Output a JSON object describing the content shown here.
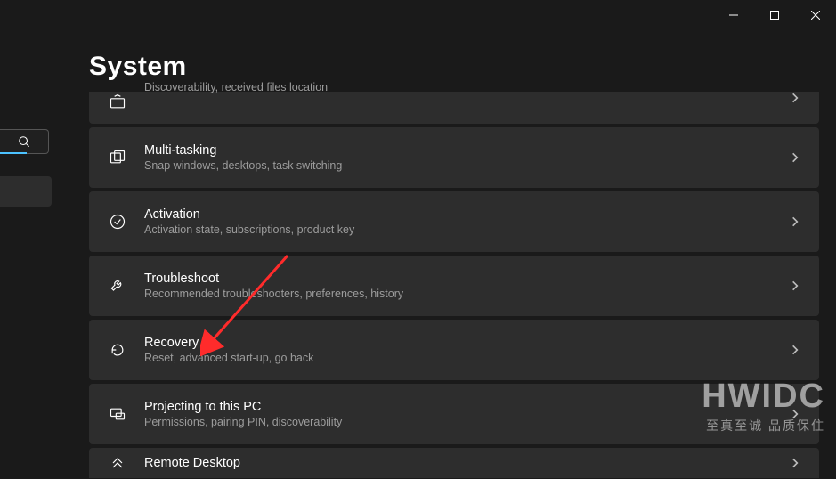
{
  "header": {
    "title": "System"
  },
  "rows": [
    {
      "title": "",
      "subtitle": "Discoverability, received files location"
    },
    {
      "title": "Multi-tasking",
      "subtitle": "Snap windows, desktops, task switching"
    },
    {
      "title": "Activation",
      "subtitle": "Activation state, subscriptions, product key"
    },
    {
      "title": "Troubleshoot",
      "subtitle": "Recommended troubleshooters, preferences, history"
    },
    {
      "title": "Recovery",
      "subtitle": "Reset, advanced start-up, go back"
    },
    {
      "title": "Projecting to this PC",
      "subtitle": "Permissions, pairing PIN, discoverability"
    },
    {
      "title": "Remote Desktop",
      "subtitle": ""
    }
  ],
  "watermark": {
    "main": "HWIDC",
    "sub": "至真至诚  品质保住"
  }
}
